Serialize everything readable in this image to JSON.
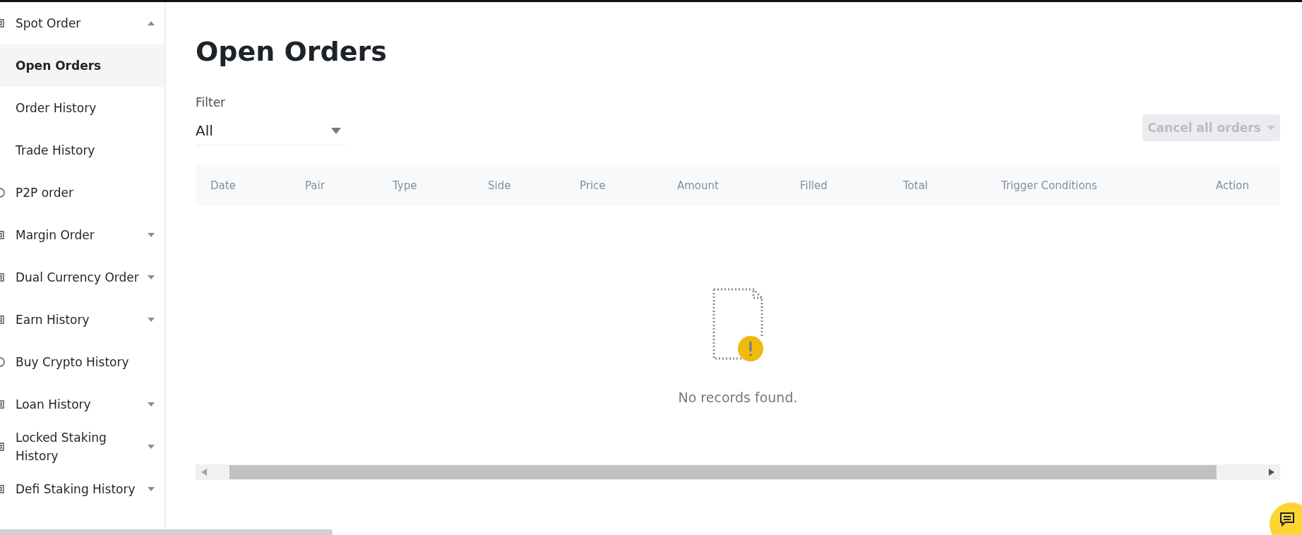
{
  "sidebar": {
    "items": [
      {
        "label": "Spot Order",
        "kind": "group",
        "expanded": true,
        "children": [
          {
            "label": "Open Orders",
            "selected": true
          },
          {
            "label": "Order History",
            "selected": false
          },
          {
            "label": "Trade History",
            "selected": false
          }
        ]
      },
      {
        "label": "P2P order",
        "kind": "item"
      },
      {
        "label": "Margin Order",
        "kind": "group",
        "expanded": false
      },
      {
        "label": "Dual Currency Order",
        "kind": "group",
        "expanded": false
      },
      {
        "label": "Earn History",
        "kind": "group",
        "expanded": false
      },
      {
        "label": "Buy Crypto History",
        "kind": "item"
      },
      {
        "label": "Loan History",
        "kind": "group",
        "expanded": false
      },
      {
        "label": "Locked Staking History",
        "kind": "group",
        "expanded": false
      },
      {
        "label": "Defi Staking History",
        "kind": "group",
        "expanded": false
      }
    ]
  },
  "page": {
    "title": "Open Orders",
    "filter": {
      "label": "Filter",
      "value": "All"
    },
    "cancel_button": {
      "label": "Cancel all orders",
      "disabled": true
    },
    "table": {
      "columns": [
        "Date",
        "Pair",
        "Type",
        "Side",
        "Price",
        "Amount",
        "Filled",
        "Total",
        "Trigger Conditions",
        "Action"
      ],
      "empty_message": "No records found."
    }
  }
}
